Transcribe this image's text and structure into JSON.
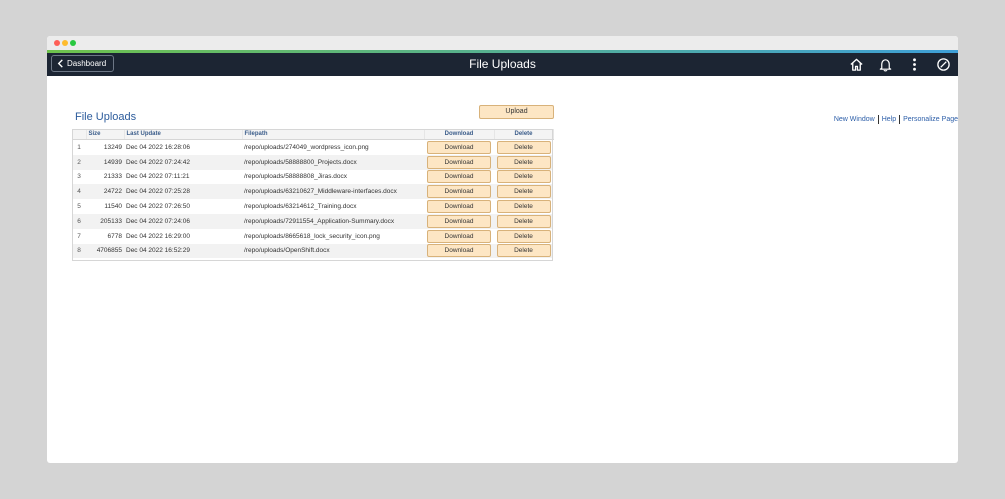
{
  "window": {
    "controls": [
      "close",
      "minimize",
      "maximize"
    ]
  },
  "navbar": {
    "back_label": "Dashboard",
    "title": "File Uploads",
    "icons": [
      "home-icon",
      "bell-icon",
      "more-icon",
      "action-icon"
    ]
  },
  "links": {
    "new_window": "New Window",
    "help": "Help",
    "personalize": "Personalize Page"
  },
  "page": {
    "heading": "File Uploads",
    "upload_label": "Upload"
  },
  "table": {
    "columns": {
      "size": "Size",
      "last_update": "Last Update",
      "filepath": "Filepath",
      "download": "Download",
      "delete": "Delete"
    },
    "rows": [
      {
        "num": "1",
        "size": "13249",
        "updated": "Dec 04 2022 16:28:06",
        "path": "/repo/uploads/274049_wordpress_icon.png",
        "download": "Download",
        "delete": "Delete"
      },
      {
        "num": "2",
        "size": "14939",
        "updated": "Dec 04 2022 07:24:42",
        "path": "/repo/uploads/58888800_Projects.docx",
        "download": "Download",
        "delete": "Delete"
      },
      {
        "num": "3",
        "size": "21333",
        "updated": "Dec 04 2022 07:11:21",
        "path": "/repo/uploads/58888808_Jiras.docx",
        "download": "Download",
        "delete": "Delete"
      },
      {
        "num": "4",
        "size": "24722",
        "updated": "Dec 04 2022 07:25:28",
        "path": "/repo/uploads/63210627_Middleware-interfaces.docx",
        "download": "Download",
        "delete": "Delete"
      },
      {
        "num": "5",
        "size": "11540",
        "updated": "Dec 04 2022 07:26:50",
        "path": "/repo/uploads/63214612_Training.docx",
        "download": "Download",
        "delete": "Delete"
      },
      {
        "num": "6",
        "size": "205133",
        "updated": "Dec 04 2022 07:24:06",
        "path": "/repo/uploads/72911554_Application-Summary.docx",
        "download": "Download",
        "delete": "Delete"
      },
      {
        "num": "7",
        "size": "6778",
        "updated": "Dec 04 2022 16:29:00",
        "path": "/repo/uploads/8665618_lock_security_icon.png",
        "download": "Download",
        "delete": "Delete"
      },
      {
        "num": "8",
        "size": "4706855",
        "updated": "Dec 04 2022 16:52:29",
        "path": "/repo/uploads/OpenShift.docx",
        "download": "Download",
        "delete": "Delete"
      }
    ]
  },
  "colors": {
    "navbar": "#1c2533",
    "button": "#fde6c4",
    "heading": "#2d5c9c",
    "link": "#2c5ea8"
  }
}
